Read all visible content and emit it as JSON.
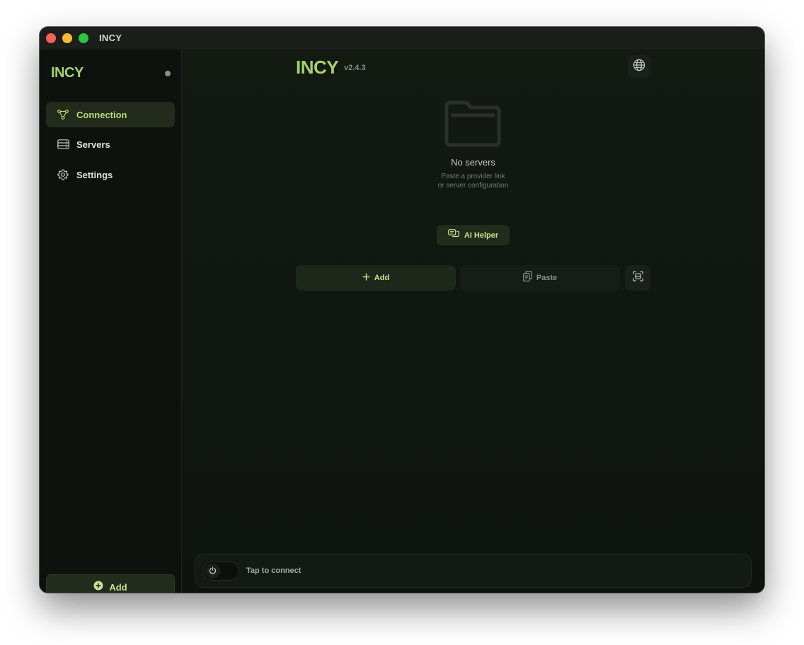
{
  "window": {
    "title": "INCY"
  },
  "sidebar": {
    "brand": "INCY",
    "items": [
      {
        "label": "Connection",
        "icon": "connection-icon",
        "active": true
      },
      {
        "label": "Servers",
        "icon": "servers-icon",
        "active": false
      },
      {
        "label": "Settings",
        "icon": "gear-icon",
        "active": false
      }
    ],
    "add_button": {
      "label": "Add",
      "icon": "plus-circle-icon"
    }
  },
  "header": {
    "logo": "INCY",
    "version": "v2.4.3",
    "language_icon": "globe-icon"
  },
  "empty_state": {
    "icon": "folder-icon",
    "title": "No servers",
    "subtitle_line1": "Paste a provider link",
    "subtitle_line2": "or server configuration",
    "ai_helper_label": "AI Helper"
  },
  "actions": {
    "add_label": "Add",
    "paste_label": "Paste",
    "scan_icon": "qr-scan-icon"
  },
  "connection": {
    "label": "Tap to connect",
    "toggle_icon": "power-icon",
    "connected": false
  },
  "colors": {
    "accent": "#a6d26b",
    "accent_text": "#c8e490",
    "background": "#0f140f",
    "active_bg": "#232b1c"
  }
}
